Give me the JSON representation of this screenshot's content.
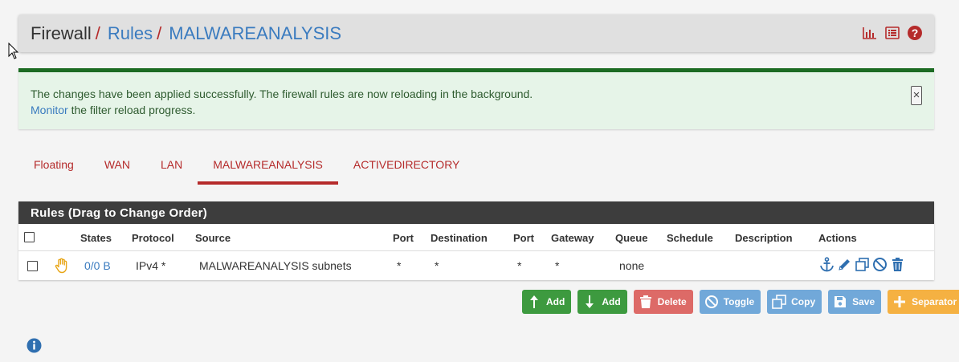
{
  "breadcrumb": {
    "items": [
      "Firewall",
      "Rules",
      "MALWAREANALYSIS"
    ],
    "separator": "/"
  },
  "header_icons": [
    "bar-chart-icon",
    "list-icon",
    "help-icon"
  ],
  "alert": {
    "line1": "The changes have been applied successfully. The firewall rules are now reloading in the background.",
    "link": "Monitor",
    "line2_rest": " the filter reload progress.",
    "close": "×"
  },
  "tabs": [
    "Floating",
    "WAN",
    "LAN",
    "MALWAREANALYSIS",
    "ACTIVEDIRECTORY"
  ],
  "active_tab": "MALWAREANALYSIS",
  "panel": {
    "title": "Rules (Drag to Change Order)",
    "columns": [
      "States",
      "Protocol",
      "Source",
      "Port",
      "Destination",
      "Port",
      "Gateway",
      "Queue",
      "Schedule",
      "Description",
      "Actions"
    ],
    "rows": [
      {
        "states": "0/0 B",
        "protocol": "IPv4 *",
        "source": "MALWAREANALYSIS subnets",
        "source_port": "*",
        "destination": "*",
        "destination_port": "*",
        "gateway": "*",
        "queue": "none",
        "schedule": "",
        "description": "",
        "action_icons": [
          "anchor-icon",
          "pencil-icon",
          "copy-icon",
          "disable-icon",
          "trash-icon"
        ]
      }
    ]
  },
  "buttons": {
    "add_top": "Add",
    "add_bottom": "Add",
    "delete": "Delete",
    "toggle": "Toggle",
    "copy": "Copy",
    "save": "Save",
    "separator": "Separator"
  },
  "colors": {
    "brand_red": "#b52b2b",
    "link_blue": "#3a7bbf",
    "success_green": "#1c6b23",
    "button_green": "#3d9a3f",
    "button_blue": "#5b9bd5",
    "button_red": "#d9534f",
    "button_orange": "#f6a623"
  }
}
